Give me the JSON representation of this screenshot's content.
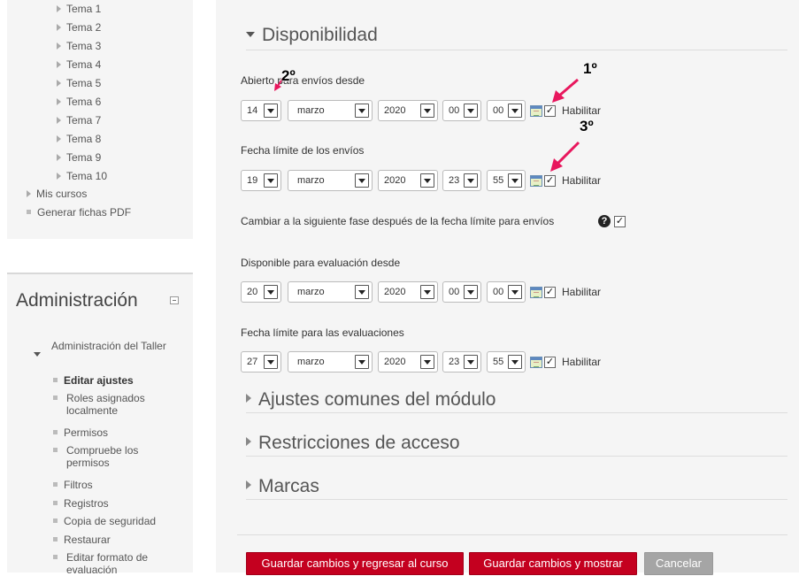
{
  "nav": {
    "topics": [
      "Tema 1",
      "Tema 2",
      "Tema 3",
      "Tema 4",
      "Tema 5",
      "Tema 6",
      "Tema 7",
      "Tema 8",
      "Tema 9",
      "Tema 10"
    ],
    "my_courses": "Mis cursos",
    "generate_pdf": "Generar fichas PDF"
  },
  "admin": {
    "title": "Administración",
    "section": "Administración del Taller",
    "items": [
      "Editar ajustes",
      "Roles asignados localmente",
      "Permisos",
      "Compruebe los permisos",
      "Filtros",
      "Registros",
      "Copia de seguridad",
      "Restaurar",
      "Editar formato de evaluación"
    ]
  },
  "availability": {
    "heading": "Disponibilidad",
    "enable_label": "Habilitar",
    "fields": [
      {
        "label": "Abierto para envíos desde",
        "day": "14",
        "month": "marzo",
        "year": "2020",
        "hour": "00",
        "minute": "00",
        "enabled": true
      },
      {
        "label": "Fecha límite de los envíos",
        "day": "19",
        "month": "marzo",
        "year": "2020",
        "hour": "23",
        "minute": "55",
        "enabled": true
      },
      {
        "label": "Disponible para evaluación desde",
        "day": "20",
        "month": "marzo",
        "year": "2020",
        "hour": "00",
        "minute": "00",
        "enabled": true
      },
      {
        "label": "Fecha límite para las evaluaciones",
        "day": "27",
        "month": "marzo",
        "year": "2020",
        "hour": "23",
        "minute": "55",
        "enabled": true
      }
    ],
    "phase_switch_label": "Cambiar a la siguiente fase después de la fecha límite para envíos",
    "phase_switch_checked": true
  },
  "collapsed_sections": [
    "Ajustes comunes del módulo",
    "Restricciones de acceso",
    "Marcas"
  ],
  "buttons": {
    "save_return": "Guardar cambios y regresar al curso",
    "save_display": "Guardar cambios y mostrar",
    "cancel": "Cancelar"
  },
  "annotations": [
    "1º",
    "2º",
    "3º"
  ],
  "colors": {
    "accent_red": "#c4001f",
    "annotation_arrow": "#e8175d",
    "cancel_grey": "#a5a5a5"
  }
}
